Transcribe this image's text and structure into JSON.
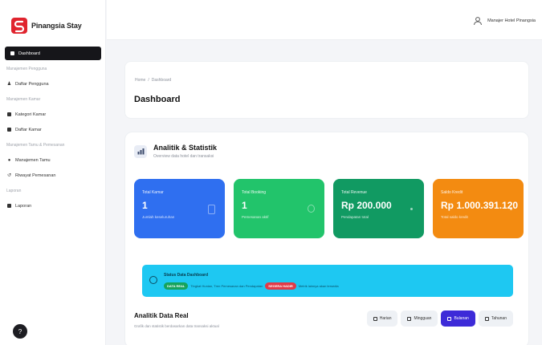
{
  "app": {
    "name": "Pinangsia Stay",
    "brand_color": "#e0242e"
  },
  "topbar": {
    "user_name": "Manajer Hotel Pinangsia"
  },
  "sidebar": {
    "items": [
      {
        "type": "item",
        "label": "Dashboard",
        "icon": "grid-icon",
        "active": true
      },
      {
        "type": "section",
        "label": "Manajemen Pengguna"
      },
      {
        "type": "item",
        "label": "Daftar Pengguna",
        "icon": "user-icon"
      },
      {
        "type": "section",
        "label": "Manajemen Kamar"
      },
      {
        "type": "item",
        "label": "Kategori Kamar",
        "icon": "tag-icon"
      },
      {
        "type": "item",
        "label": "Daftar Kamar",
        "icon": "bed-icon"
      },
      {
        "type": "section",
        "label": "Manajemen Tamu & Pemesanan"
      },
      {
        "type": "item",
        "label": "Manajemen Tamu",
        "icon": "users-icon"
      },
      {
        "type": "item",
        "label": "Riwayat Pemesanan",
        "icon": "history-icon"
      },
      {
        "type": "section",
        "label": "Laporan"
      },
      {
        "type": "item",
        "label": "Laporan",
        "icon": "report-icon"
      }
    ],
    "help_label": "?"
  },
  "page": {
    "breadcrumb": [
      "Home",
      "/",
      "Dashboard"
    ],
    "title": "Dashboard"
  },
  "analytics": {
    "title": "Analitik & Statistik",
    "subtitle": "Overview data hotel dan transaksi",
    "stats": [
      {
        "label": "Total Kamar",
        "value": "1",
        "note": "Jumlah keseluruhan",
        "color": "#2f6ff0"
      },
      {
        "label": "Total Booking",
        "value": "1",
        "note": "Pemesanan aktif",
        "color": "#22c46b"
      },
      {
        "label": "Total Revenue",
        "value": "Rp 200.000",
        "note": "Pendapatan total",
        "color": "#119a62"
      },
      {
        "label": "Saldo Kredit",
        "value": "Rp 1.000.391.120",
        "note": "Total saldo kredit",
        "color": "#f38b11"
      }
    ],
    "info": {
      "title": "Status Data Dashboard",
      "live_badge": "DATA REAL",
      "live_text": "Tingkat Hunian, Tren Pemesanan dan Pendapatan",
      "dummy_badge": "SEGERA HADIR",
      "dummy_text": "Metrik lainnya akan tersedia"
    },
    "real": {
      "title": "Analitik Data Real",
      "subtitle": "Grafik dan statistik berdasarkan data transaksi aktual",
      "tabs": [
        {
          "label": "Harian",
          "active": false
        },
        {
          "label": "Mingguan",
          "active": false
        },
        {
          "label": "Bulanan",
          "active": true
        },
        {
          "label": "Tahunan",
          "active": false
        }
      ]
    }
  }
}
